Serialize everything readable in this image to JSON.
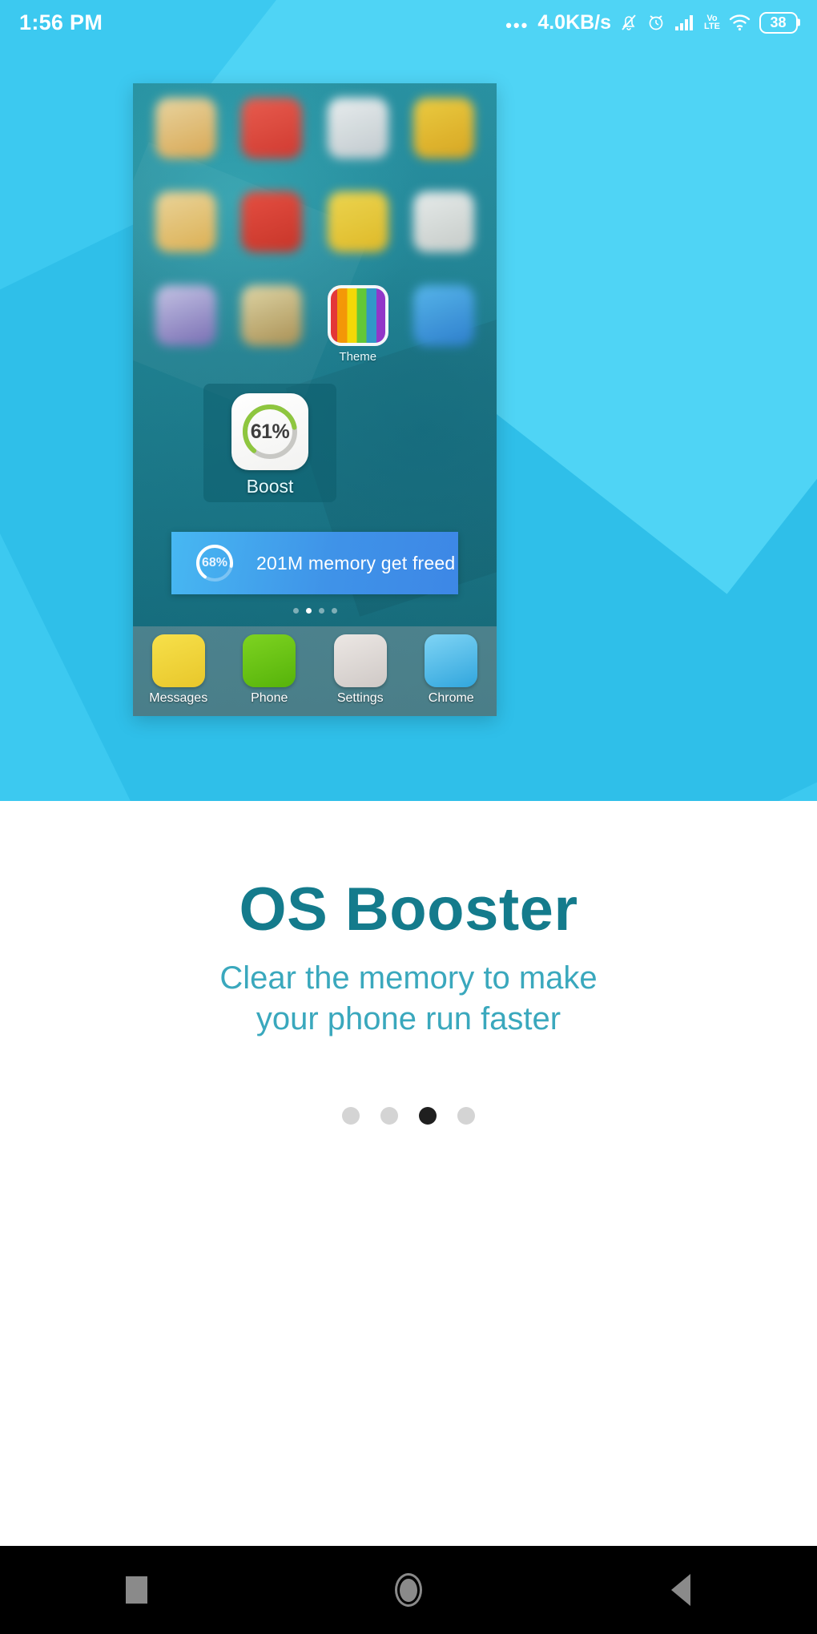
{
  "statusbar": {
    "time": "1:56 PM",
    "overflow_dots": "•••",
    "network_speed": "4.0KB/s",
    "mute_icon": "mute-bell-icon",
    "alarm_icon": "alarm-clock-icon",
    "signal_icon": "signal-bars-icon",
    "volte_top": "Vo",
    "volte_bottom": "LTE",
    "wifi_icon": "wifi-icon",
    "battery_level": "38"
  },
  "phone_preview": {
    "app_grid": [
      {
        "label": "",
        "color1": "#f2d8a0",
        "color2": "#e2a84f"
      },
      {
        "label": "",
        "color1": "#f25a4a",
        "color2": "#d9342a"
      },
      {
        "label": "",
        "color1": "#f2f2f2",
        "color2": "#c9ccd0"
      },
      {
        "label": "",
        "color1": "#f6cf3c",
        "color2": "#e0a71c"
      },
      {
        "label": "",
        "color1": "#f4d89a",
        "color2": "#e5b04e"
      },
      {
        "label": "",
        "color1": "#ee4b3c",
        "color2": "#cf2f22"
      },
      {
        "label": "",
        "color1": "#f7d94b",
        "color2": "#e8bb22"
      },
      {
        "label": "",
        "color1": "#f0f0ee",
        "color2": "#cfcfcb"
      },
      {
        "label": "",
        "color1": "#cdc7e8",
        "color2": "#7d6cb5"
      },
      {
        "label": "",
        "color1": "#e8d9a6",
        "color2": "#b09050"
      },
      {
        "label": "Theme",
        "color1": "#ffffff",
        "color2": "#f0f0f0"
      },
      {
        "label": "",
        "color1": "#5ab8ef",
        "color2": "#2f7fd0"
      }
    ],
    "theme_label": "Theme",
    "boost_widget": {
      "percent": "61%",
      "percent_value": 61,
      "label": "Boost",
      "arc_color": "#8ec63f",
      "track_color": "#c8c8c4"
    },
    "memory_banner": {
      "percent": "68%",
      "percent_value": 68,
      "message": "201M memory get freed"
    },
    "inner_page_dots": {
      "count": 4,
      "active_index": 1
    },
    "dock": [
      {
        "label": "Messages",
        "color1": "#f7e04a",
        "color2": "#e8c72b"
      },
      {
        "label": "Phone",
        "color1": "#7ed321",
        "color2": "#56b30a"
      },
      {
        "label": "Settings",
        "color1": "#ece7e4",
        "color2": "#cfc9c6"
      },
      {
        "label": "Chrome",
        "color1": "#7fd4f5",
        "color2": "#31a6dd"
      }
    ]
  },
  "onboarding": {
    "title": "OS Booster",
    "subtitle_line1": "Clear the memory to make",
    "subtitle_line2": "your phone run faster",
    "page_dots": {
      "count": 4,
      "active_index": 2
    }
  },
  "navbar": {
    "recents_icon": "recents-square-icon",
    "home_icon": "home-circle-icon",
    "back_icon": "back-triangle-icon"
  },
  "colors": {
    "hero_background": "#3cc9f0",
    "title_color": "#147b8c",
    "subtitle_color": "#3aa8bd",
    "active_dot": "#1f1f1f",
    "inactive_dot": "#d4d4d4"
  }
}
